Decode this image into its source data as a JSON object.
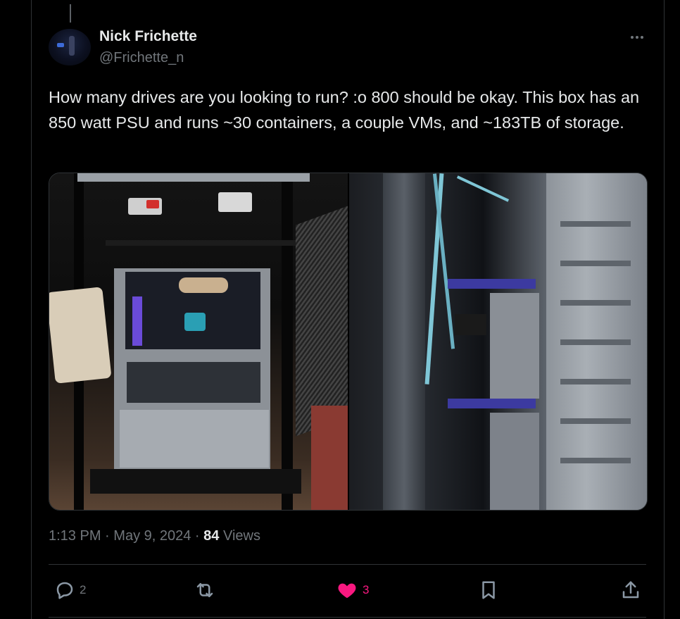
{
  "tweet": {
    "author_name": "Nick Frichette",
    "author_handle": "@Frichette_n",
    "text": "How many drives are you looking to run? :o 800 should be okay. This box has an 850 watt PSU and runs ~30 containers, a couple VMs, and ~183TB of storage.",
    "time": "1:13 PM",
    "separator": "·",
    "date": "May 9, 2024",
    "views_count": "84",
    "views_label": "Views"
  },
  "actions": {
    "reply_count": "2",
    "retweet_count": "",
    "like_count": "3",
    "like_color": "#f91880"
  },
  "media": [
    {
      "icon": "photo-server-rack"
    },
    {
      "icon": "photo-drive-bays"
    }
  ]
}
